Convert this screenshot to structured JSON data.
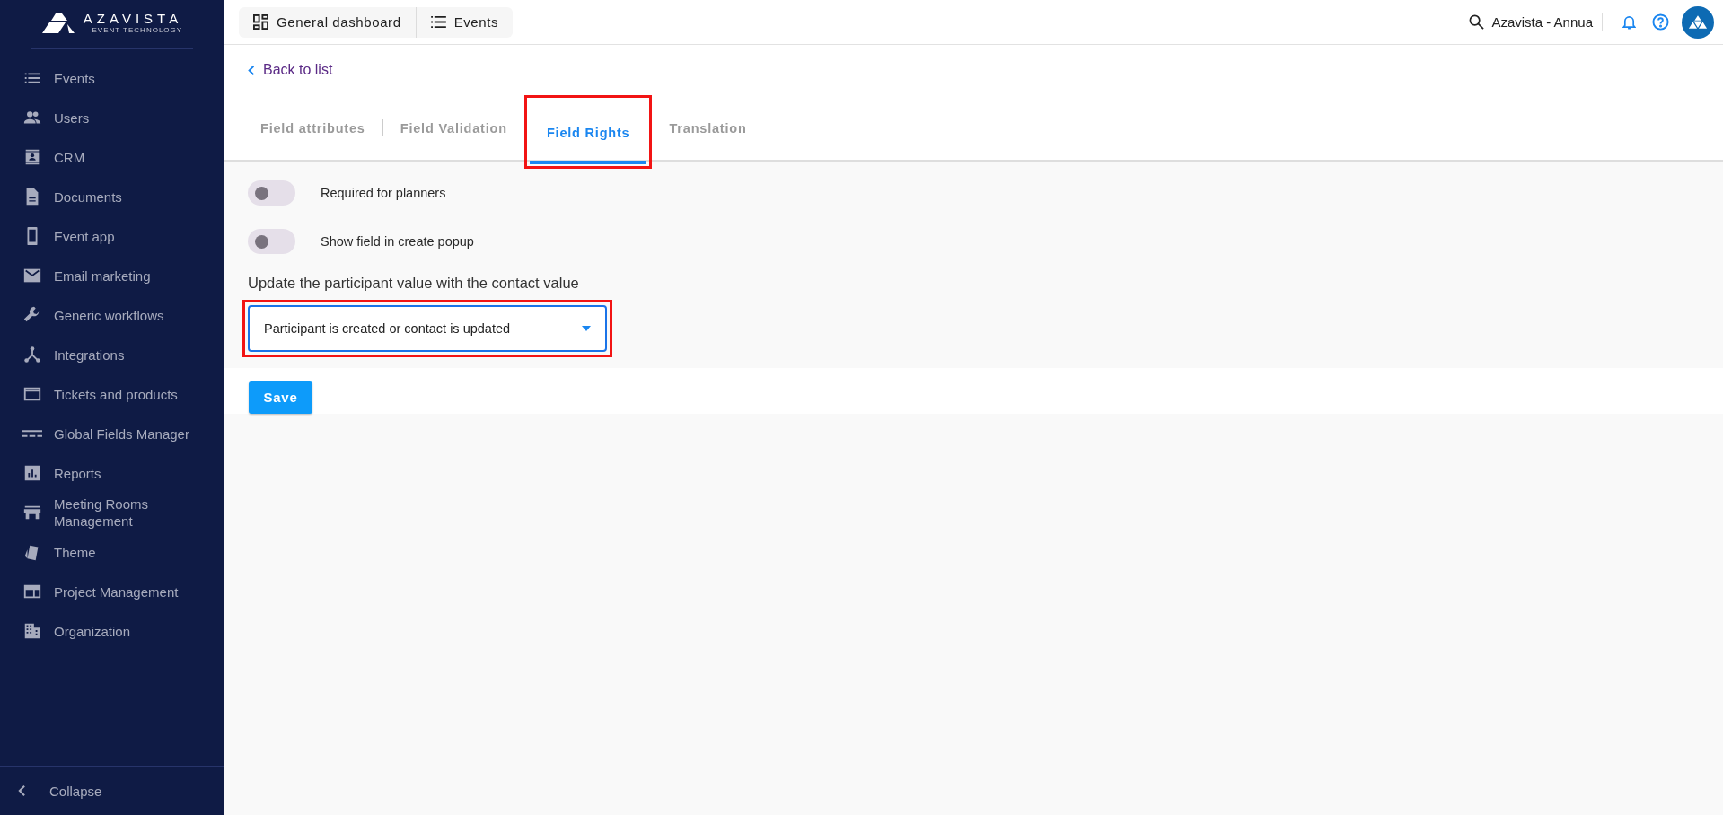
{
  "sidebar": {
    "logo": {
      "name": "AZAVISTA",
      "tagline": "EVENT TECHNOLOGY"
    },
    "items": [
      {
        "label": "Events",
        "kind": "list"
      },
      {
        "label": "Users",
        "kind": "users"
      },
      {
        "label": "CRM",
        "kind": "contact"
      },
      {
        "label": "Documents",
        "kind": "doc"
      },
      {
        "label": "Event app",
        "kind": "phone"
      },
      {
        "label": "Email marketing",
        "kind": "mail"
      },
      {
        "label": "Generic workflows",
        "kind": "wrench"
      },
      {
        "label": "Integrations",
        "kind": "merge"
      },
      {
        "label": "Tickets and products",
        "kind": "card"
      },
      {
        "label": "Global Fields Manager",
        "kind": "dashes"
      },
      {
        "label": "Reports",
        "kind": "chart"
      },
      {
        "label": "Meeting Rooms Management",
        "kind": "store"
      },
      {
        "label": "Theme",
        "kind": "swatch"
      },
      {
        "label": "Project Management",
        "kind": "panel"
      },
      {
        "label": "Organization",
        "kind": "building"
      }
    ],
    "collapse": "Collapse"
  },
  "topbar": {
    "nav": [
      {
        "label": "General dashboard",
        "kind": "grid"
      },
      {
        "label": "Events",
        "kind": "list"
      }
    ],
    "search_value": "Azavista - Annua"
  },
  "back_link": "Back to list",
  "tabs": [
    {
      "label": "Field attributes",
      "selected": false,
      "highlighted": false
    },
    {
      "label": "Field Validation",
      "selected": false,
      "highlighted": false
    },
    {
      "label": "Field Rights",
      "selected": true,
      "highlighted": true
    },
    {
      "label": "Translation",
      "selected": false,
      "highlighted": false
    }
  ],
  "toggles": [
    {
      "label": "Required for planners",
      "on": false
    },
    {
      "label": "Show field in create popup",
      "on": false
    }
  ],
  "update_label": "Update the participant value with the contact value",
  "dropdown": {
    "value": "Participant is created or contact is updated",
    "highlighted": true
  },
  "save": "Save"
}
